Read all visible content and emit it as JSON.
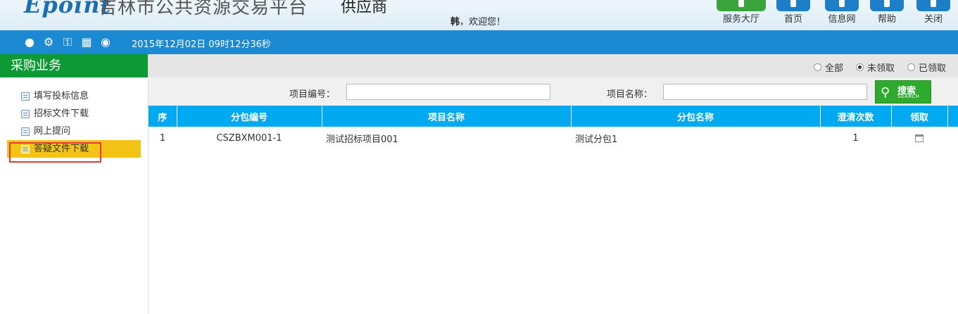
{
  "header": {
    "logo": "Epoint",
    "site_title": "吉林市公共资源交易平台",
    "role_title": "供应商",
    "welcome_name": "韩",
    "welcome_text": "，欢迎您！"
  },
  "top_nav": [
    {
      "label": "服务大厅",
      "icon": "service-hall-icon"
    },
    {
      "label": "首页",
      "icon": "home-icon"
    },
    {
      "label": "信息网",
      "icon": "info-net-icon"
    },
    {
      "label": "帮助",
      "icon": "help-icon"
    },
    {
      "label": "关闭",
      "icon": "power-icon"
    }
  ],
  "toolbar": {
    "icons": [
      "message-icon",
      "gear-icon",
      "key-icon",
      "gift-icon",
      "palette-icon"
    ],
    "datetime": "2015年12月02日 09时12分36秒"
  },
  "sidebar": {
    "title": "采购业务",
    "items": [
      {
        "label": "填写投标信息"
      },
      {
        "label": "招标文件下载"
      },
      {
        "label": "网上提问"
      },
      {
        "label": "答疑文件下载",
        "active": true
      }
    ]
  },
  "filter": {
    "options": [
      "全部",
      "未领取",
      "已领取"
    ],
    "selected": "未领取"
  },
  "search": {
    "project_no_label": "项目编号：",
    "project_no_value": "",
    "project_name_label": "项目名称：",
    "project_name_value": "",
    "button_cn": "搜索",
    "button_en": "SEARCH"
  },
  "table": {
    "columns": [
      "序",
      "分包编号",
      "项目名称",
      "分包名称",
      "澄清次数",
      "领取"
    ],
    "rows": [
      {
        "seq": "1",
        "package_no": "CSZBXM001-1",
        "project_name": "测试招标项目001",
        "package_name": "测试分包1",
        "clarify_count": "1"
      }
    ]
  },
  "colors": {
    "brand_blue": "#1b8ad3",
    "sidebar_green": "#0d9a35",
    "table_header": "#01aaf0",
    "active_item": "#f3c416",
    "search_button": "#2eaa2e"
  }
}
